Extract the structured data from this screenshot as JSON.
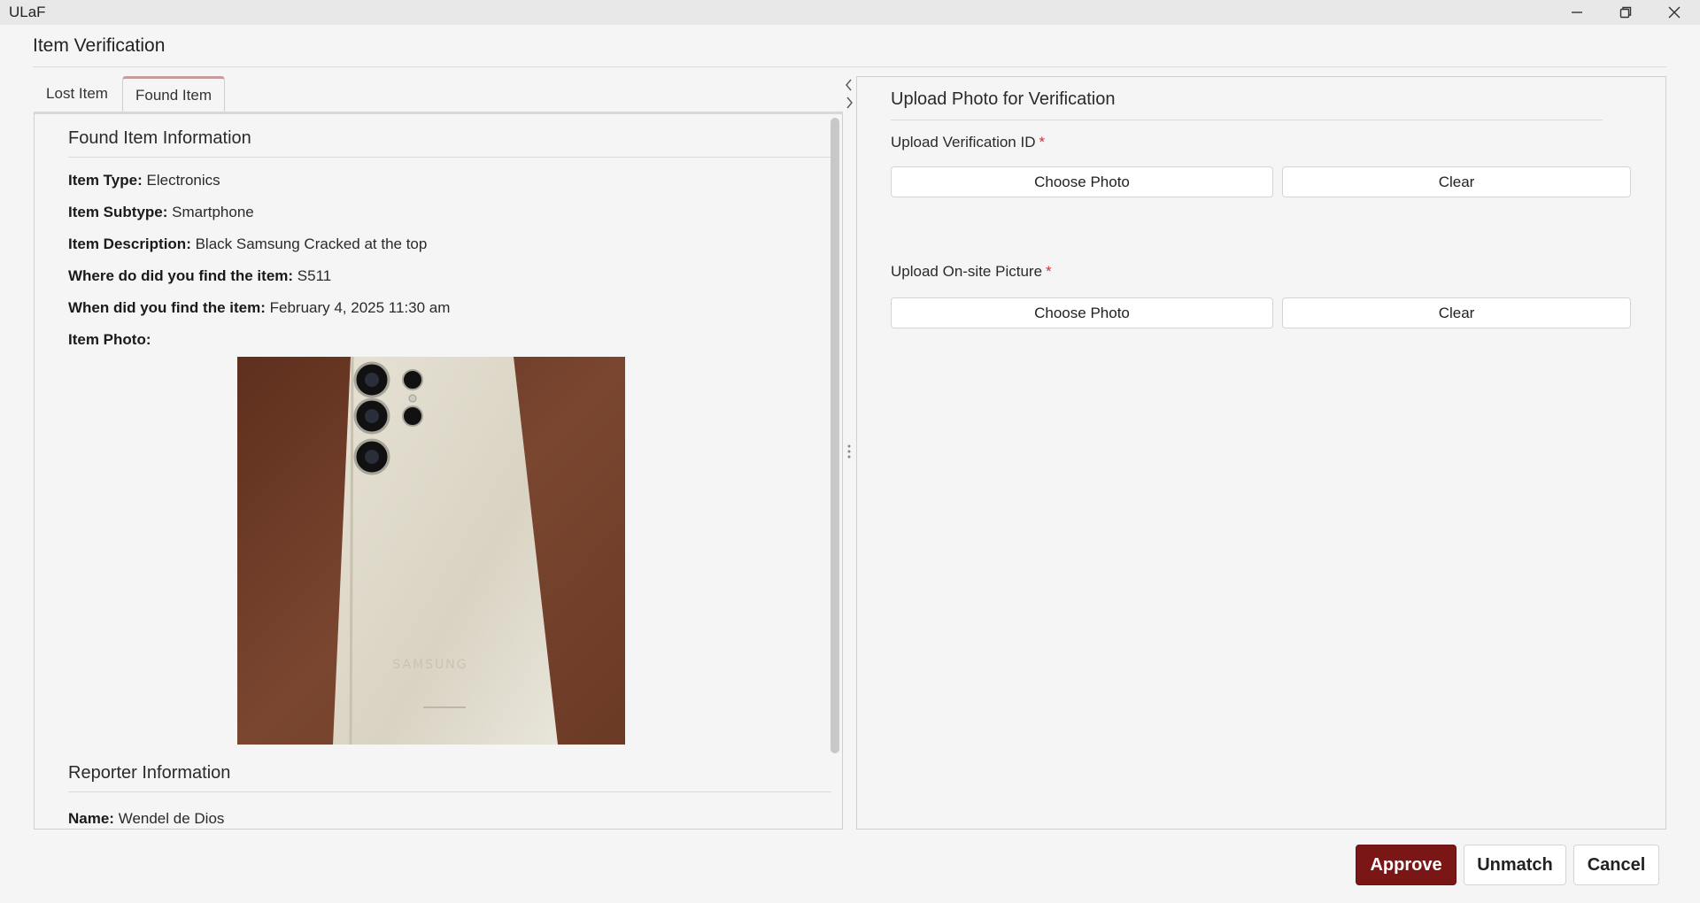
{
  "window": {
    "app_title": "ULaF"
  },
  "page": {
    "title": "Item Verification"
  },
  "tabs": [
    {
      "label": "Lost Item",
      "active": false
    },
    {
      "label": "Found Item",
      "active": true
    }
  ],
  "found_item": {
    "section_title": "Found Item Information",
    "fields": [
      {
        "label": "Item Type:",
        "value": "Electronics"
      },
      {
        "label": "Item Subtype:",
        "value": "Smartphone"
      },
      {
        "label": "Item Description:",
        "value": "Black Samsung Cracked at the top"
      },
      {
        "label": "Where do did you find the item:",
        "value": "S511"
      },
      {
        "label": "When did you find the item:",
        "value": "February 4, 2025 11:30 am"
      },
      {
        "label": "Item Photo:",
        "value": ""
      }
    ],
    "photo_brand_text": "SAMSUNG"
  },
  "reporter": {
    "section_title": "Reporter Information",
    "name_label": "Name:",
    "name_value": "Wendel de Dios"
  },
  "verification": {
    "title": "Upload Photo for Verification",
    "id_upload": {
      "label": "Upload Verification ID",
      "required_mark": "*",
      "choose_label": "Choose Photo",
      "clear_label": "Clear"
    },
    "onsite_upload": {
      "label": "Upload On-site Picture",
      "required_mark": "*",
      "choose_label": "Choose Photo",
      "clear_label": "Clear"
    }
  },
  "actions": {
    "approve": "Approve",
    "unmatch": "Unmatch",
    "cancel": "Cancel"
  },
  "colors": {
    "approve_bg": "#7a1616",
    "required": "#d32f2f",
    "photo_bg": "#6e3a26",
    "phone_body": "#ddd8c8"
  }
}
